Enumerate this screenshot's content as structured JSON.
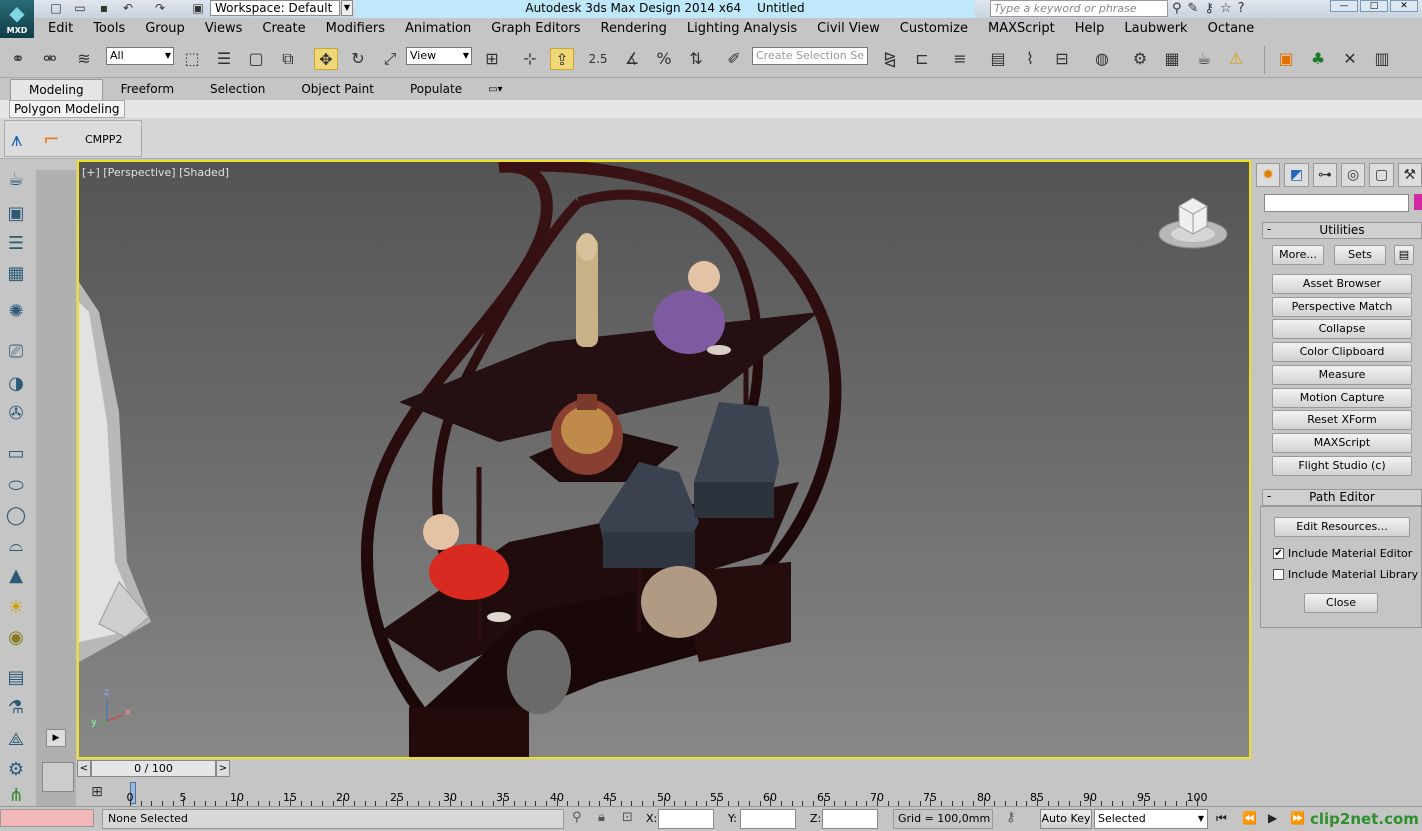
{
  "app": {
    "title": "Autodesk 3ds Max Design 2014 x64",
    "document": "Untitled",
    "logo": "MXD",
    "workspace": "Workspace: Default",
    "search_placeholder": "Type a keyword or phrase"
  },
  "menu": [
    "Edit",
    "Tools",
    "Group",
    "Views",
    "Create",
    "Modifiers",
    "Animation",
    "Graph Editors",
    "Rendering",
    "Lighting Analysis",
    "Civil View",
    "Customize",
    "MAXScript",
    "Help",
    "Laubwerk",
    "Octane"
  ],
  "toolbar": {
    "selection_filter": "All",
    "reference_coord": "View",
    "snap_label": "2.5",
    "selection_set_placeholder": "Create Selection Se"
  },
  "ribbon": {
    "tabs": [
      "Modeling",
      "Freeform",
      "Selection",
      "Object Paint",
      "Populate"
    ],
    "active_tab": "Modeling",
    "subtab": "Polygon Modeling",
    "group_label": "CMPP2"
  },
  "viewport": {
    "label": "[+] [Perspective] [Shaded]",
    "axis_x": "x",
    "axis_y": "y",
    "axis_z": "z"
  },
  "command_panel": {
    "utilities": {
      "title": "Utilities",
      "more_button": "More...",
      "sets_button": "Sets",
      "buttons": [
        "Asset Browser",
        "Perspective Match",
        "Collapse",
        "Color Clipboard",
        "Measure",
        "Motion Capture",
        "Reset XForm",
        "MAXScript",
        "Flight Studio (c)"
      ]
    },
    "path_editor": {
      "title": "Path Editor",
      "edit_resources": "Edit Resources...",
      "include_material_editor": "Include Material Editor",
      "include_material_editor_checked": true,
      "include_material_library": "Include Material Library",
      "include_material_library_checked": false,
      "close_button": "Close"
    }
  },
  "timeline": {
    "frame_display": "0 / 100",
    "ticks": [
      "0",
      "5",
      "10",
      "15",
      "20",
      "25",
      "30",
      "35",
      "40",
      "45",
      "50",
      "55",
      "60",
      "65",
      "70",
      "75",
      "80",
      "85",
      "90",
      "95",
      "100"
    ]
  },
  "status": {
    "selection_text": "None Selected",
    "x_label": "X:",
    "y_label": "Y:",
    "z_label": "Z:",
    "grid": "Grid = 100,0mm",
    "auto_key": "Auto Key",
    "key_mode": "Selected",
    "watermark": "clip2net.com"
  }
}
